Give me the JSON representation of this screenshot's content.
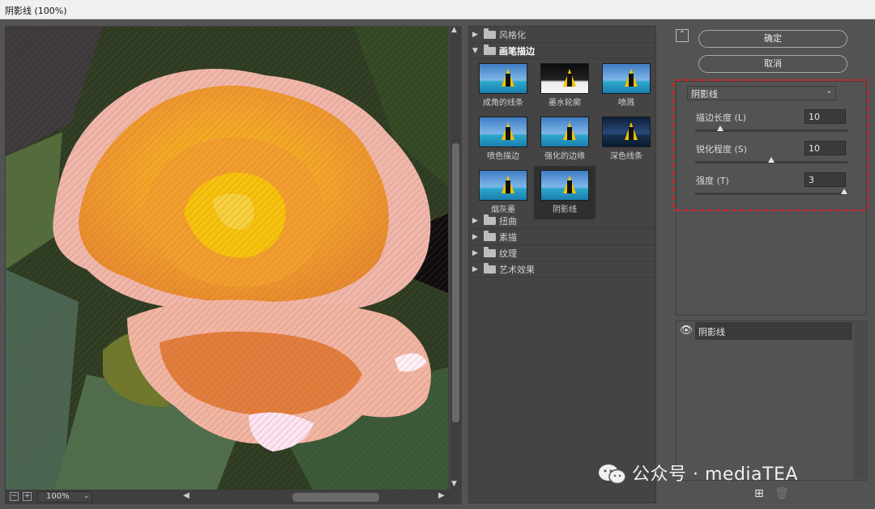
{
  "window": {
    "title": "阴影线 (100%)"
  },
  "preview": {
    "zoom": "100%",
    "zoom_out_icon": "minus-icon",
    "zoom_in_icon": "plus-icon"
  },
  "gallery": {
    "categories_top": [
      {
        "label": "风格化",
        "expanded": false
      },
      {
        "label": "画笔描边",
        "expanded": true
      }
    ],
    "thumbnails": [
      {
        "label": "成角的线条",
        "style": "normal"
      },
      {
        "label": "墨水轮廓",
        "style": "ink"
      },
      {
        "label": "喷溅",
        "style": "normal"
      },
      {
        "label": "喷色描边",
        "style": "normal"
      },
      {
        "label": "强化的边缘",
        "style": "normal"
      },
      {
        "label": "深色线条",
        "style": "dark"
      },
      {
        "label": "烟灰墨",
        "style": "normal"
      },
      {
        "label": "阴影线",
        "style": "normal",
        "selected": true
      }
    ],
    "categories_bottom": [
      {
        "label": "扭曲"
      },
      {
        "label": "素描"
      },
      {
        "label": "纹理"
      },
      {
        "label": "艺术效果"
      }
    ]
  },
  "panel": {
    "ok_label": "确定",
    "cancel_label": "取消",
    "filter_select": "阴影线",
    "params": [
      {
        "label": "描边长度 (L)",
        "value": "10",
        "fraction": 0.15
      },
      {
        "label": "锐化程度 (S)",
        "value": "10",
        "fraction": 0.5
      },
      {
        "label": "强度 (T)",
        "value": "3",
        "fraction": 1.0
      }
    ]
  },
  "layers": {
    "items": [
      {
        "name": "阴影线",
        "visible": true
      }
    ],
    "new_icon": "new-layer-icon",
    "delete_icon": "trash-icon"
  },
  "watermark": {
    "text": "公众号 · mediaTEA"
  }
}
